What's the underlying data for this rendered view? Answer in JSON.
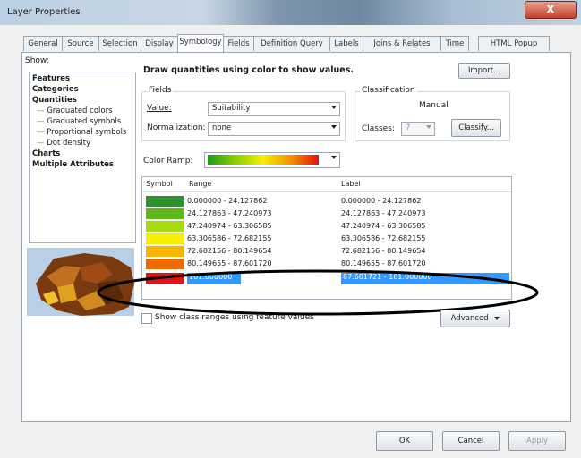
{
  "window": {
    "title": "Layer Properties",
    "close_glyph": "X"
  },
  "tabs": [
    "General",
    "Source",
    "Selection",
    "Display",
    "Symbology",
    "Fields",
    "Definition Query",
    "Labels",
    "Joins & Relates",
    "Time",
    "HTML Popup"
  ],
  "show": {
    "label": "Show:",
    "items": [
      {
        "label": "Features",
        "bold": true
      },
      {
        "label": "Categories",
        "bold": true
      },
      {
        "label": "Quantities",
        "bold": true
      },
      {
        "label": "Graduated colors",
        "bold": false
      },
      {
        "label": "Graduated symbols",
        "bold": false
      },
      {
        "label": "Proportional symbols",
        "bold": false
      },
      {
        "label": "Dot density",
        "bold": false
      },
      {
        "label": "Charts",
        "bold": true
      },
      {
        "label": "Multiple Attributes",
        "bold": true
      }
    ]
  },
  "heading": "Draw quantities using color to show values.",
  "import_button": "Import...",
  "fields": {
    "group": "Fields",
    "value_label": "Value:",
    "value": "Suitability",
    "norm_label": "Normalization:",
    "norm": "none"
  },
  "classification": {
    "group": "Classification",
    "method": "Manual",
    "classes_label": "Classes:",
    "classes": "7",
    "classify_button": "Classify..."
  },
  "color_ramp_label": "Color Ramp:",
  "table": {
    "headers": [
      "Symbol",
      "Range",
      "Label"
    ],
    "rows": [
      {
        "color": "#2f8f2f",
        "range": "0.000000 - 24.127862",
        "label": "0.000000 - 24.127862"
      },
      {
        "color": "#5fb81c",
        "range": "24.127863 - 47.240973",
        "label": "24.127863 - 47.240973"
      },
      {
        "color": "#a8d80e",
        "range": "47.240974 - 63.306585",
        "label": "47.240974 - 63.306585"
      },
      {
        "color": "#f6f000",
        "range": "63.306586 - 72.682155",
        "label": "63.306586 - 72.682155"
      },
      {
        "color": "#f7b500",
        "range": "72.682156 - 80.149654",
        "label": "72.682156 - 80.149654"
      },
      {
        "color": "#f06a00",
        "range": "80.149655 - 87.601720",
        "label": "80.149655 - 87.601720"
      },
      {
        "color": "#e81010",
        "range": "101.000000",
        "label": "87.601721 - 101.000000"
      }
    ]
  },
  "show_ranges_label": "Show class ranges using feature values",
  "advanced_button": "Advanced",
  "buttons": {
    "ok": "OK",
    "cancel": "Cancel",
    "apply": "Apply"
  }
}
